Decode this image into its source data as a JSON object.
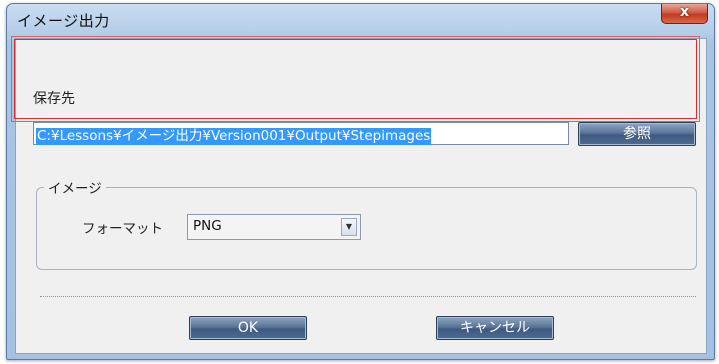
{
  "dialog": {
    "title": "イメージ出力",
    "close_label": "x"
  },
  "save_destination": {
    "label": "保存先",
    "path_value": "C:¥Lessons¥イメージ出力¥Version001¥Output¥Stepimages",
    "browse_label": "参照"
  },
  "image_group": {
    "legend": "イメージ",
    "format_label": "フォーマット",
    "format_value": "PNG",
    "dropdown_icon": "chevron-down-icon"
  },
  "footer": {
    "ok_label": "OK",
    "cancel_label": "キャンセル"
  },
  "colors": {
    "selection": "#3399ff",
    "highlight_border": "#d43030",
    "title_bar": "#b7cfe9",
    "button": "#4f6b92",
    "close_button": "#c23a22"
  }
}
